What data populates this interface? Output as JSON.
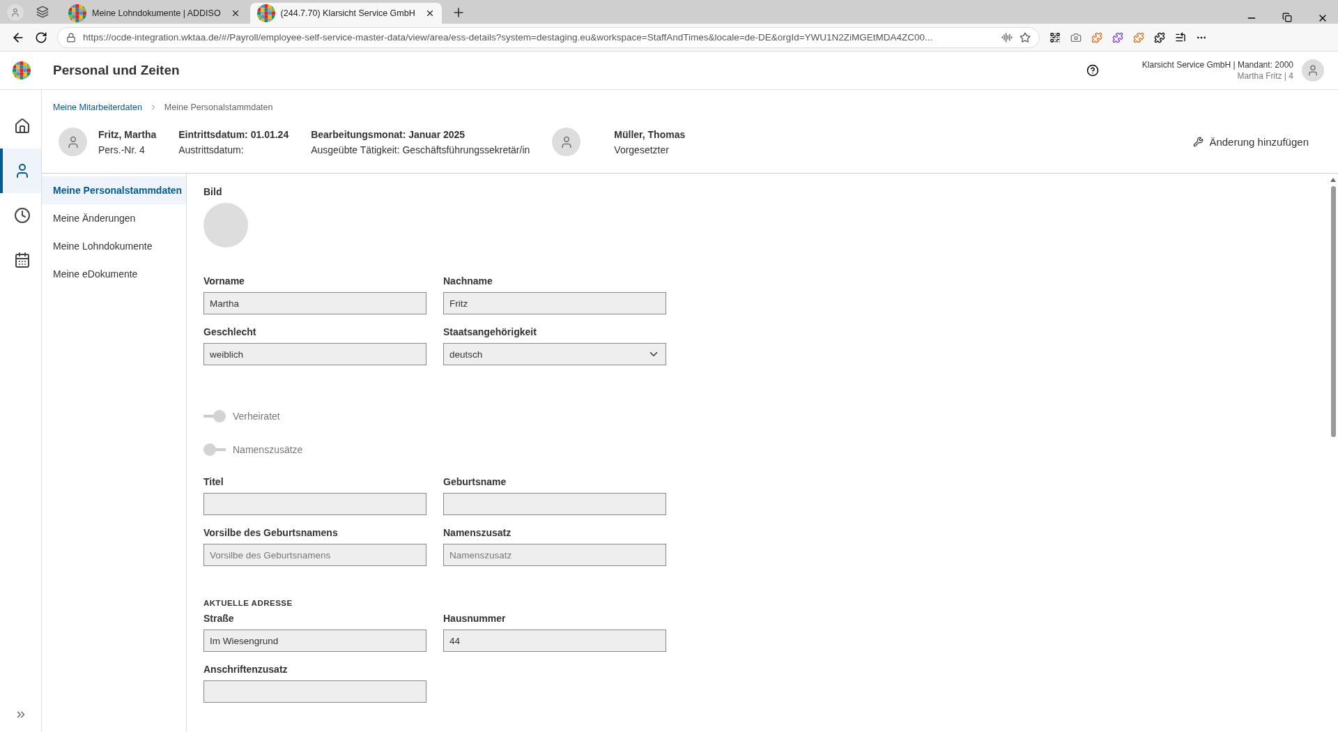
{
  "browser": {
    "tabs": [
      {
        "title": "Meine Lohndokumente | ADDISO",
        "selected": false
      },
      {
        "title": "(244.7.70) Klarsicht Service GmbH",
        "selected": true
      }
    ],
    "url": "https://ocde-integration.wktaa.de/#/Payroll/employee-self-service-master-data/view/area/ess-details?system=destaging.eu&workspace=StaffAndTimes&locale=de-DE&orgId=YWU1N2ZiMGEtMDA4ZC00..."
  },
  "app": {
    "title": "Personal und Zeiten",
    "company": "Klarsicht Service GmbH | Mandant: 2000",
    "user": "Martha Fritz | 4"
  },
  "rail": [
    {
      "kind": "home",
      "selected": false
    },
    {
      "kind": "person",
      "selected": true
    },
    {
      "kind": "clock",
      "selected": false
    },
    {
      "kind": "calendar",
      "selected": false
    }
  ],
  "breadcrumb": [
    {
      "label": "Meine Mitarbeiterdaten",
      "link": true
    },
    {
      "label": "Meine Personalstammdaten",
      "link": false
    }
  ],
  "employee": {
    "name": "Fritz, Martha",
    "number": "Pers.-Nr. 4",
    "entry": "Eintrittsdatum: 01.01.24",
    "exit": "Austrittsdatum:",
    "month": "Bearbeitungsmonat: Januar 2025",
    "activity": "Ausgeübte Tätigkeit: Geschäftsführungssekretär/in",
    "supervisor": "Müller, Thomas",
    "supervisor_role": "Vorgesetzter"
  },
  "action": "Änderung hinzufügen",
  "subnav": [
    {
      "label": "Meine Personalstammdaten",
      "selected": true
    },
    {
      "label": "Meine Änderungen",
      "selected": false
    },
    {
      "label": "Meine Lohndokumente",
      "selected": false
    },
    {
      "label": "Meine eDokumente",
      "selected": false
    }
  ],
  "form": [
    {
      "kind": "image",
      "label": "Bild"
    },
    {
      "kind": "fields",
      "fields": [
        {
          "label": "Vorname",
          "value": "Martha",
          "kind": "text"
        },
        {
          "label": "Nachname",
          "value": "Fritz",
          "kind": "text"
        }
      ]
    },
    {
      "kind": "fields",
      "fields": [
        {
          "label": "Geschlecht",
          "value": "weiblich",
          "kind": "text"
        },
        {
          "label": "Staatsangehörigkeit",
          "value": "deutsch",
          "kind": "select"
        }
      ]
    },
    {
      "kind": "toggle",
      "label": "Verheiratet",
      "on": true,
      "disabled": true
    },
    {
      "kind": "toggle",
      "label": "Namenszusätze",
      "on": false,
      "disabled": true
    },
    {
      "kind": "fields",
      "fields": [
        {
          "label": "Titel",
          "kind": "text"
        },
        {
          "label": "Geburtsname",
          "kind": "text"
        }
      ]
    },
    {
      "kind": "fields",
      "fields": [
        {
          "label": "Vorsilbe des Geburtsnamens",
          "placeholder": "Vorsilbe des Geburtsnamens",
          "kind": "text"
        },
        {
          "label": "Namenszusatz",
          "placeholder": "Namenszusatz",
          "kind": "text"
        }
      ]
    },
    {
      "kind": "heading",
      "label": "AKTUELLE ADRESSE"
    },
    {
      "kind": "fields",
      "fields": [
        {
          "label": "Straße",
          "value": "Im Wiesengrund",
          "kind": "text"
        },
        {
          "label": "Hausnummer",
          "value": "44",
          "kind": "text"
        }
      ]
    },
    {
      "kind": "fields",
      "fields": [
        {
          "label": "Anschriftenzusatz",
          "kind": "text"
        }
      ]
    }
  ]
}
